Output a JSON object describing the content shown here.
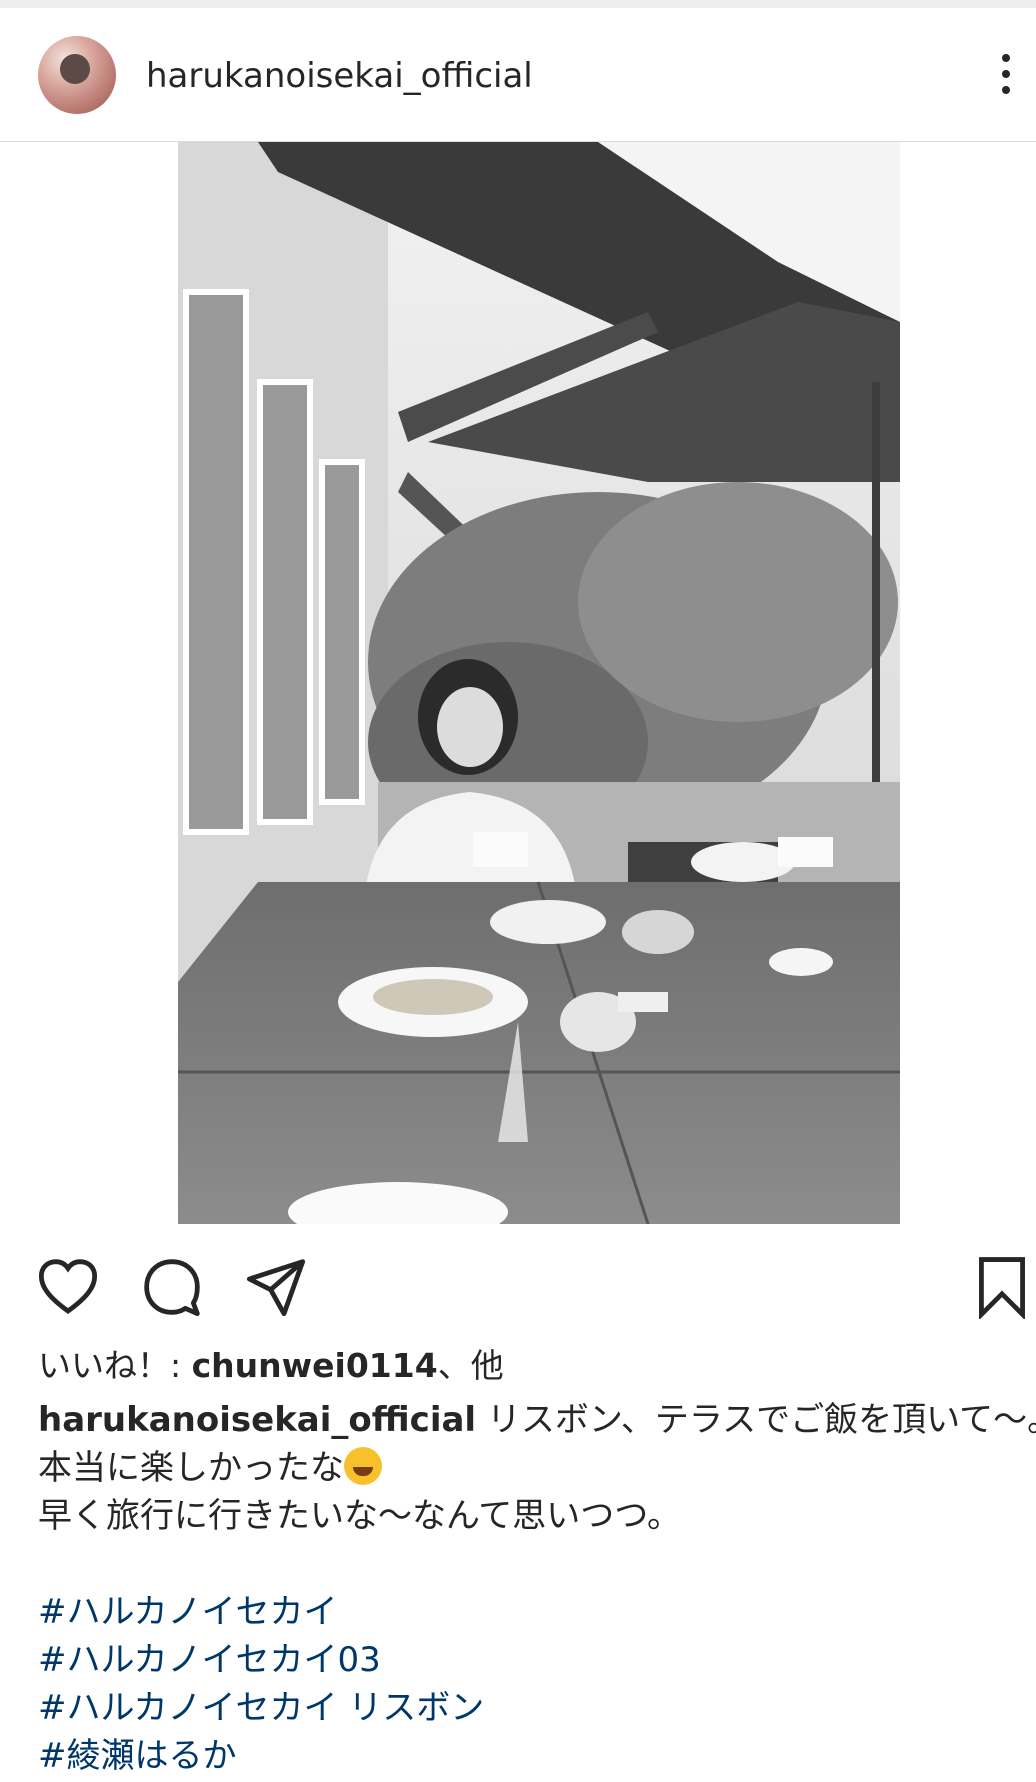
{
  "post": {
    "username": "harukanoisekai_official"
  },
  "likes": {
    "prefix": "いいね！: ",
    "liked_by": "chunwei0114",
    "suffix": "、他"
  },
  "caption": {
    "user": "harukanoisekai_official",
    "line1": " リスボン、テラスでご飯を頂いて〜。",
    "line2": "本当に楽しかったな",
    "line2_emoji": "rolling-on-floor-laughing-emoji",
    "line3": "早く旅行に行きたいな〜なんて思いつつ。",
    "hashtags": [
      "#ハルカノイセカイ",
      "#ハルカノイセカイ03",
      "#ハルカノイセカイ リスボン",
      "#綾瀬はるか"
    ]
  },
  "icons": {
    "more": "more-vertical-icon",
    "like": "heart-icon",
    "comment": "comment-icon",
    "share": "send-icon",
    "save": "bookmark-icon"
  },
  "colors": {
    "text": "#262626",
    "hashtag": "#00376b",
    "divider": "#dbdbdb"
  },
  "photo": {
    "description_icon": "photo-black-and-white"
  }
}
